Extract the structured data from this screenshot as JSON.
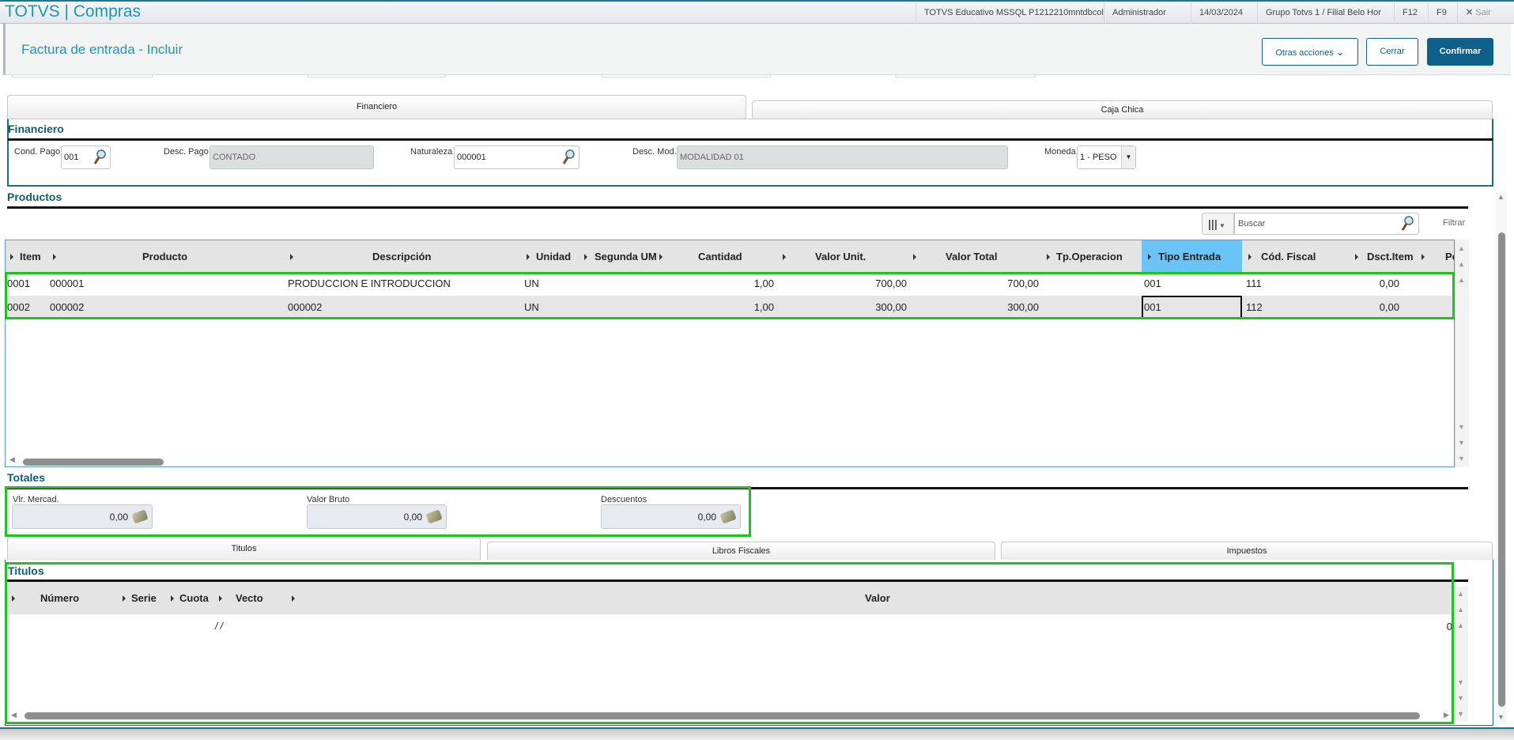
{
  "topbar": {
    "app_title": "TOTVS | Compras",
    "environment": "TOTVS Educativo MSSQL P1212210mntdbcol",
    "user": "Administrador",
    "date": "14/03/2024",
    "branch": "Grupo Totvs 1 / Filial Belo Hor",
    "f12": "F12",
    "f9": "F9",
    "exit": "Sair"
  },
  "header": {
    "title": "Factura de entrada - Incluir",
    "other_actions": "Otras acciones",
    "close": "Cerrar",
    "confirm": "Confirmar"
  },
  "tabs_top": [
    {
      "label": "Financiero",
      "active": true
    },
    {
      "label": "Caja Chica",
      "active": false
    }
  ],
  "financiero": {
    "title": "Financiero",
    "cond_pago": {
      "label": "Cond. Pago",
      "value": "001"
    },
    "desc_pago": {
      "label": "Desc. Pago",
      "value": "CONTADO"
    },
    "naturaleza": {
      "label": "Naturaleza",
      "value": "000001"
    },
    "desc_mod": {
      "label": "Desc. Mod.",
      "value": "MODALIDAD 01"
    },
    "moneda": {
      "label": "Moneda",
      "value": "1 - PESO"
    }
  },
  "productos": {
    "title": "Productos",
    "search_placeholder": "Buscar",
    "filter": "Filtrar",
    "columns": [
      "Item",
      "Producto",
      "Descripción",
      "Unidad",
      "Segunda UM",
      "Cantidad",
      "Valor Unit.",
      "Valor Total",
      "Tp.Operacion",
      "Tipo Entrada",
      "Cód. Fiscal",
      "Dsct.Item",
      "Pe"
    ],
    "highlighted_column": "Tipo Entrada",
    "rows": [
      {
        "item": "0001",
        "producto": "000001",
        "descripcion": "PRODUCCION E INTRODUCCION",
        "unidad": "UN",
        "cantidad": "1,00",
        "valor_unit": "700,00",
        "valor_total": "700,00",
        "tipo_entrada": "001",
        "cod_fiscal": "111",
        "dsct_item": "0,00"
      },
      {
        "item": "0002",
        "producto": "000002",
        "descripcion": "000002",
        "unidad": "UN",
        "cantidad": "1,00",
        "valor_unit": "300,00",
        "valor_total": "300,00",
        "tipo_entrada": "001",
        "cod_fiscal": "112",
        "dsct_item": "0,00"
      }
    ]
  },
  "totales": {
    "title": "Totales",
    "fields": [
      {
        "label": "Vlr. Mercad.",
        "value": "0,00"
      },
      {
        "label": "Valor Bruto",
        "value": "0,00"
      },
      {
        "label": "Descuentos",
        "value": "0,00"
      }
    ]
  },
  "tabs_bottom": [
    {
      "label": "Titulos",
      "active": true
    },
    {
      "label": "Libros Fiscales",
      "active": false
    },
    {
      "label": "Impuestos",
      "active": false
    }
  ],
  "titulos": {
    "title": "Titulos",
    "columns": [
      "Número",
      "Serie",
      "Cuota",
      "Vecto",
      "Valor"
    ],
    "rows": [
      {
        "vecto": "/ /",
        "valor": "0"
      }
    ]
  },
  "colors": {
    "accent": "#1a96b8",
    "primary_button": "#0e5f8a",
    "section_title": "#0c5d78",
    "highlight_header": "#6ac4f8",
    "selection_outline": "#1ec41e"
  }
}
